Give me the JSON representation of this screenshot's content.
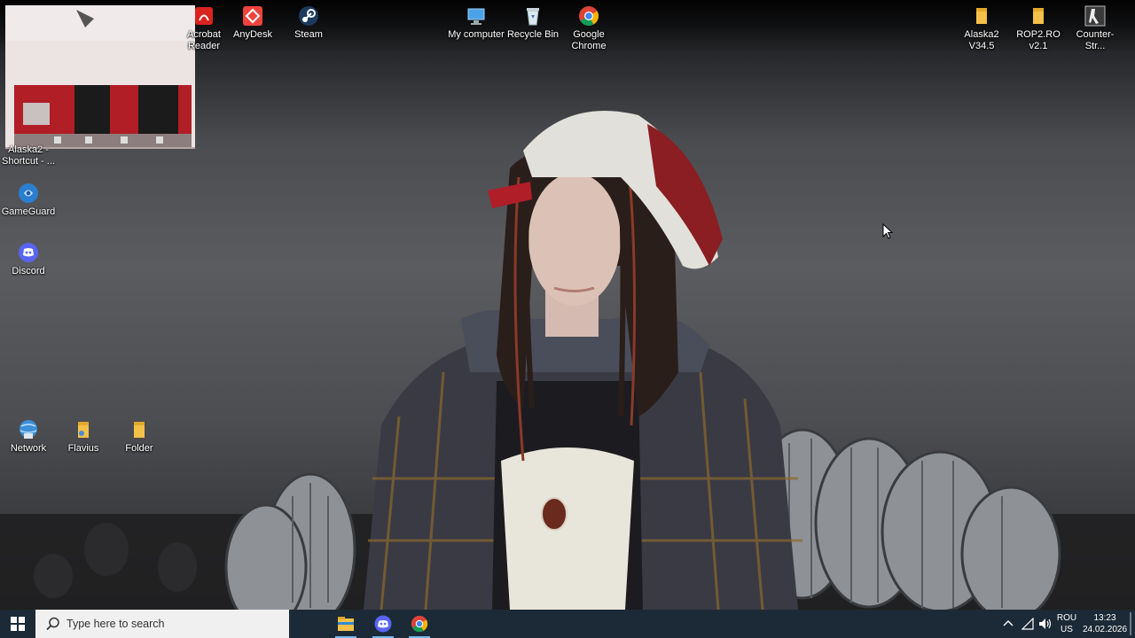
{
  "desktop": {
    "icons": [
      {
        "id": "acrobat",
        "label": "Acrobat Reader",
        "icon": "acrobat-icon"
      },
      {
        "id": "anydesk",
        "label": "AnyDesk",
        "icon": "anydesk-icon"
      },
      {
        "id": "steam",
        "label": "Steam",
        "icon": "steam-icon"
      },
      {
        "id": "my_computer",
        "label": "My computer",
        "icon": "computer-icon"
      },
      {
        "id": "recycle_bin",
        "label": "Recycle Bin",
        "icon": "recycle-bin-icon"
      },
      {
        "id": "chrome",
        "label": "Google Chrome",
        "icon": "chrome-icon"
      },
      {
        "id": "alaska_v345",
        "label": "Alaska2 V34.5",
        "icon": "folder-icon"
      },
      {
        "id": "rop2",
        "label": "ROP2.RO v2.1",
        "icon": "folder-icon"
      },
      {
        "id": "counter_strike",
        "label": "Counter-Str...",
        "icon": "counter-strike-icon"
      },
      {
        "id": "alaska_shortcut",
        "label": "Alaska2 - Shortcut - ...",
        "icon": "shortcut-icon"
      },
      {
        "id": "gameguard",
        "label": "GameGuard",
        "icon": "gameguard-icon"
      },
      {
        "id": "discord",
        "label": "Discord",
        "icon": "discord-icon"
      },
      {
        "id": "network",
        "label": "Network",
        "icon": "network-icon"
      },
      {
        "id": "flavius",
        "label": "Flavius",
        "icon": "user-folder-icon"
      },
      {
        "id": "folder",
        "label": "Folder",
        "icon": "folder-icon"
      }
    ]
  },
  "taskbar": {
    "search_placeholder": "Type here to search",
    "pinned": [
      {
        "id": "file_explorer",
        "icon": "file-explorer-icon",
        "active": true
      },
      {
        "id": "discord",
        "icon": "discord-icon",
        "active": true
      },
      {
        "id": "chrome",
        "icon": "chrome-icon",
        "active": true
      }
    ],
    "tray": {
      "language_top": "ROU",
      "language_bottom": "US",
      "time": "13:23",
      "date": "24.02.2026"
    }
  },
  "colors": {
    "taskbar_bg": "#1b2a36",
    "active_underline": "#76b9ed",
    "folder_yellow": "#f3c04a"
  }
}
